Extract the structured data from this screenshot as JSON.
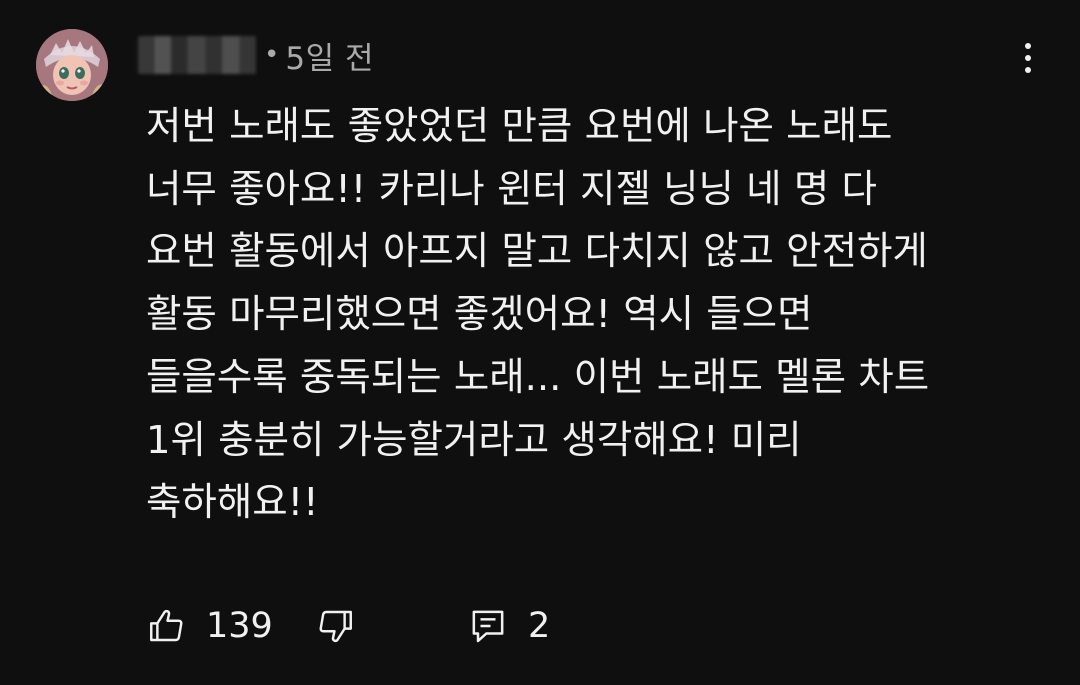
{
  "comment": {
    "time": "5일 전",
    "text_lines": [
      "저번 노래도 좋았었던 만큼 요번에 나온 노래도",
      "너무 좋아요!! 카리나 윈터 지젤 닝닝 네 명 다",
      "요번 활동에서 아프지 말고 다치지 않고 안전하게",
      "활동 마무리했으면 좋겠어요! 역시 들으면",
      "들을수록 중독되는 노래... 이번 노래도 멜론 차트",
      "1위 충분히 가능할거라고 생각해요! 미리",
      "축하해요!!"
    ],
    "likes": "139",
    "replies": "2"
  },
  "icons": {
    "like": "thumbs-up-icon",
    "dislike": "thumbs-down-icon",
    "reply": "comment-icon",
    "menu": "more-vert-icon"
  },
  "colors": {
    "background": "#0f0f0f",
    "text": "#f1f1f1",
    "secondary_text": "#aaaaaa"
  }
}
